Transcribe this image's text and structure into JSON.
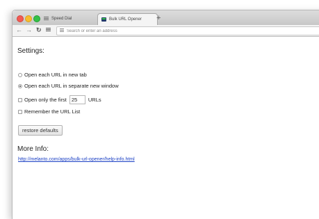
{
  "browser": {
    "tabs": [
      {
        "label": "Speed Dial",
        "icon": "speed-dial-icon"
      },
      {
        "label": "Bulk URL Opener",
        "icon": "bulk-url-opener-icon",
        "active": true
      }
    ],
    "new_tab_label": "+",
    "address_bar": {
      "value": "",
      "placeholder": "Search or enter an address"
    }
  },
  "page": {
    "settings_heading": "Settings:",
    "options": {
      "new_tab": {
        "label": "Open each URL in new tab",
        "selected": false
      },
      "new_window": {
        "label": "Open each URL in separate new window",
        "selected": true
      },
      "first_n": {
        "label_before": "Open only the first",
        "value": "25",
        "label_after": "URLs",
        "checked": false
      },
      "remember": {
        "label": "Remember the URL List",
        "checked": false
      }
    },
    "restore_button": "restore defaults",
    "more_info_heading": "More Info:",
    "info_link": "http://melanto.com/apps/bulk-url-opener/help-info.html"
  },
  "colors": {
    "link": "#1a3fc4",
    "close": "#f25b54",
    "minimize": "#f7bd2f",
    "zoom": "#34c048"
  }
}
